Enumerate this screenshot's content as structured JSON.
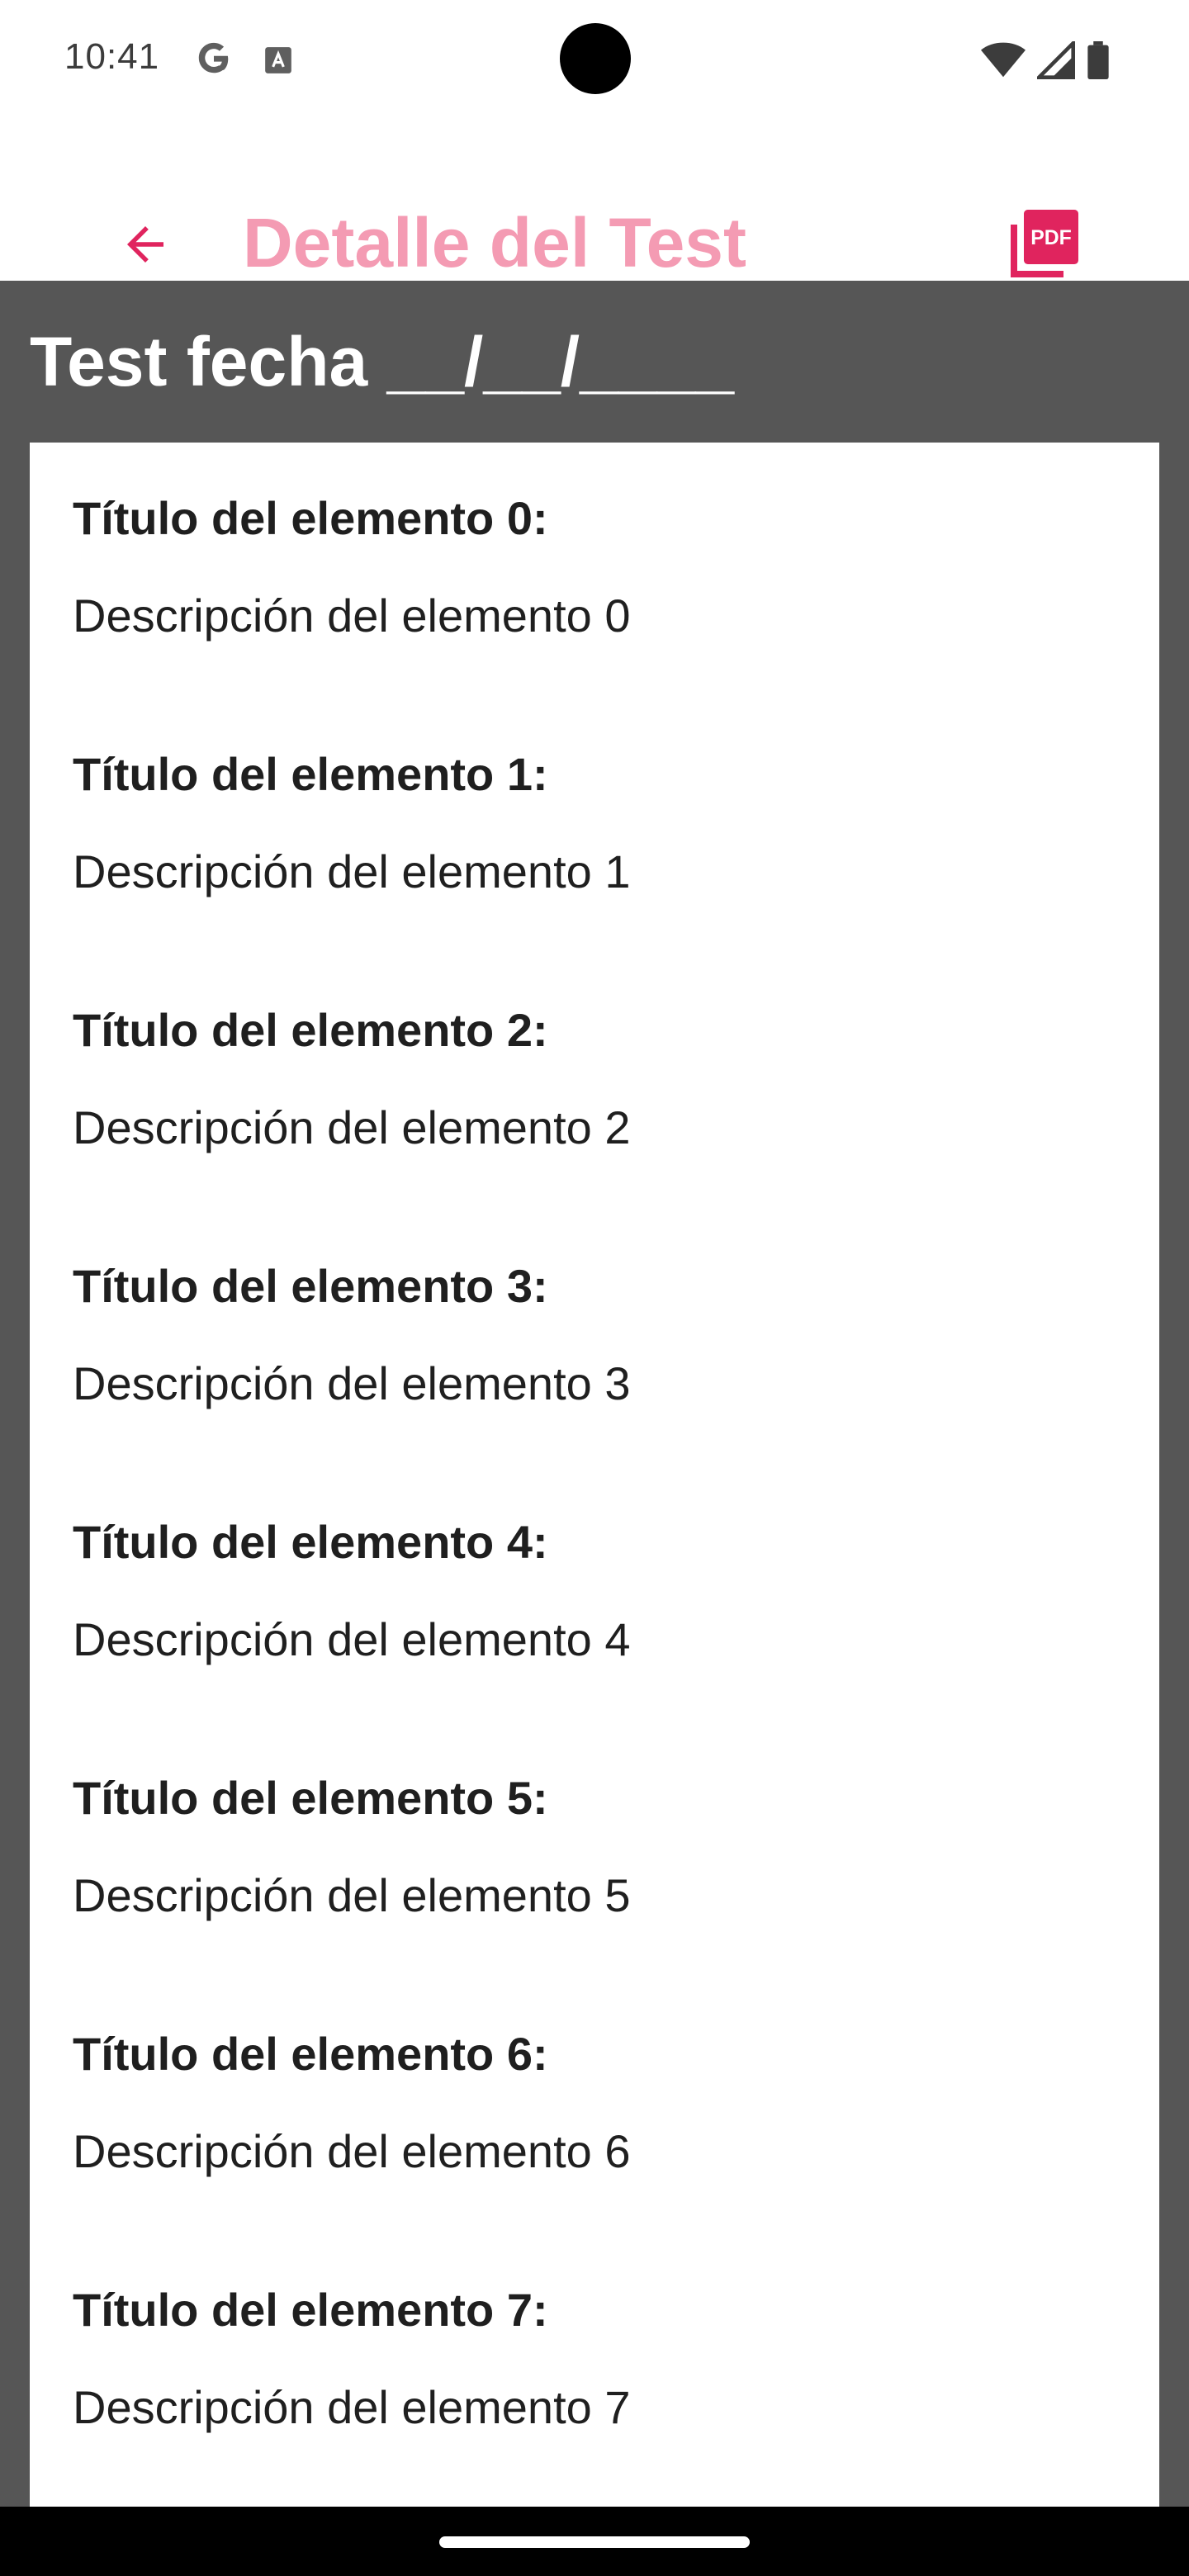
{
  "status_bar": {
    "time": "10:41",
    "icons": [
      "google-icon",
      "font-icon",
      "wifi-icon",
      "signal-icon",
      "battery-icon"
    ]
  },
  "app_bar": {
    "title": "Detalle del Test",
    "back_icon": "arrow-back-icon",
    "pdf_icon": "pdf-icon",
    "accent_color": "#e0245e",
    "title_color": "#f49bb3"
  },
  "main": {
    "background": "#565656",
    "test_date": "Test fecha __/__/____"
  },
  "items": [
    {
      "title": "Título del elemento 0:",
      "description": "Descripción del elemento 0"
    },
    {
      "title": "Título del elemento 1:",
      "description": "Descripción del elemento 1"
    },
    {
      "title": "Título del elemento 2:",
      "description": "Descripción del elemento 2"
    },
    {
      "title": "Título del elemento 3:",
      "description": "Descripción del elemento 3"
    },
    {
      "title": "Título del elemento 4:",
      "description": "Descripción del elemento 4"
    },
    {
      "title": "Título del elemento 5:",
      "description": "Descripción del elemento 5"
    },
    {
      "title": "Título del elemento 6:",
      "description": "Descripción del elemento 6"
    },
    {
      "title": "Título del elemento 7:",
      "description": "Descripción del elemento 7"
    }
  ]
}
